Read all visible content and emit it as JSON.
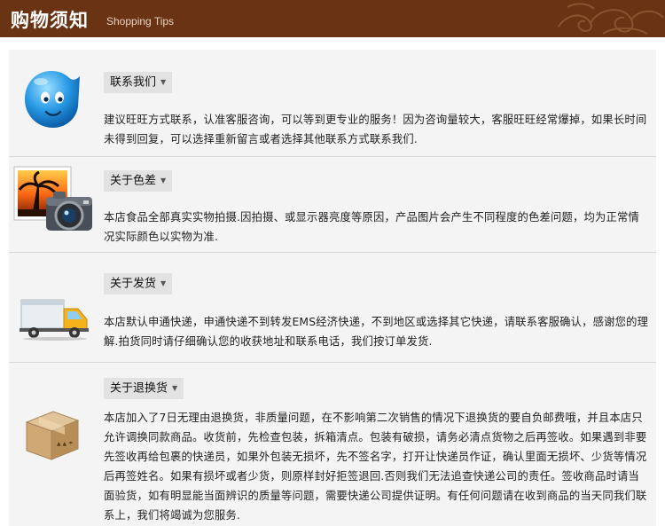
{
  "header": {
    "title": "购物须知",
    "subtitle": "Shopping Tips"
  },
  "sections": [
    {
      "tag": "联系我们",
      "icon": "aliwangwang-chat-icon",
      "text": "建议旺旺方式联系，认准客服咨询，可以等到更专业的服务！因为咨询量较大，客服旺旺经常爆掉，如果长时间未得到回复，可以选择重新留言或者选择其他联系方式联系我们."
    },
    {
      "tag": "关于色差",
      "icon": "camera-photo-icon",
      "text": "本店食品全部真实实物拍摄.因拍摄、或显示器亮度等原因，产品图片会产生不同程度的色差问题，均为正常情况实际颜色以实物为准."
    },
    {
      "tag": "关于发货",
      "icon": "delivery-truck-icon",
      "text": "本店默认申通快递，申通快递不到转发EMS经济快递，不到地区或选择其它快递，请联系客服确认，感谢您的理解.拍货同时请仔细确认您的收获地址和联系电话，我们按订单发货."
    },
    {
      "tag": "关于退换货",
      "icon": "cardboard-box-icon",
      "text": "本店加入了7日无理由退换货，非质量问题，在不影响第二次销售的情况下退换货的要自负邮费哦，并且本店只允许调换同款商品。收货前，先检查包装，拆箱清点。包装有破损，请务必清点货物之后再签收。如果遇到非要先签收再给包裹的快递员，如果外包装无损坏，先不签名字，打开让快递员作证，确认里面无损坏、少货等情况后再签姓名。如果有损坏或者少货，则原样封好拒签退回.否则我们无法追查快递公司的责任。签收商品时请当面验货，如有明显能当面辨识的质量等问题，需要快递公司提供证明。有任何问题请在收到商品的当天同我们联系上，我们将竭诚为您服务."
    }
  ],
  "colors": {
    "header_bg": "#6a3414",
    "panel_bg": "#f4f4f4",
    "tag_bg": "#e2e2e2"
  }
}
